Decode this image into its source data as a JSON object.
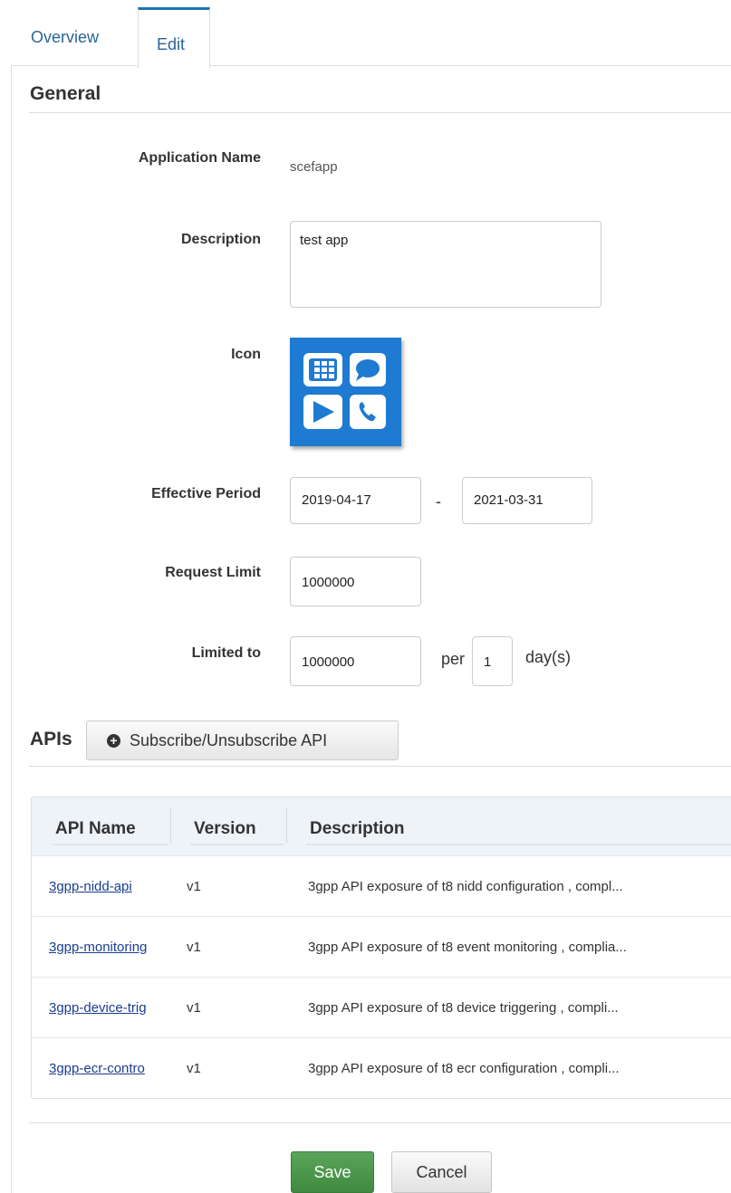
{
  "tabs": {
    "overview": "Overview",
    "edit": "Edit"
  },
  "general": {
    "title": "General",
    "application_name_label": "Application Name",
    "application_name_value": "scefapp",
    "description_label": "Description",
    "description_value": "test app",
    "icon_label": "Icon",
    "effective_period_label": "Effective Period",
    "effective_start": "2019-04-17",
    "effective_separator": "-",
    "effective_end": "2021-03-31",
    "request_limit_label": "Request Limit",
    "request_limit_value": "1000000",
    "limited_to_label": "Limited to",
    "limited_to_value": "1000000",
    "per_text": "per",
    "per_value": "1",
    "unit_text": "day(s)"
  },
  "apis": {
    "title": "APIs",
    "subscribe_button": "Subscribe/Unsubscribe API",
    "columns": [
      "API Name",
      "Version",
      "Description"
    ],
    "rows": [
      {
        "name": "3gpp-nidd-api",
        "version": "v1",
        "description": "3gpp API exposure of t8 nidd configuration , compl..."
      },
      {
        "name": "3gpp-monitoring",
        "version": "v1",
        "description": "3gpp API exposure of t8 event monitoring , complia..."
      },
      {
        "name": "3gpp-device-trig",
        "version": "v1",
        "description": "3gpp API exposure of t8 device triggering , compli..."
      },
      {
        "name": "3gpp-ecr-contro",
        "version": "v1",
        "description": "3gpp API exposure of t8 ecr configuration , compli..."
      }
    ]
  },
  "footer": {
    "save": "Save",
    "cancel": "Cancel"
  },
  "colors": {
    "accent": "#1f73b7",
    "icon_bg": "#1f7ad1",
    "save_green": "#4a9a4a",
    "link": "#1a3d8f"
  },
  "icons": {
    "app_icon": "app-grid-icon",
    "subscribe": "plus-circle-icon"
  }
}
